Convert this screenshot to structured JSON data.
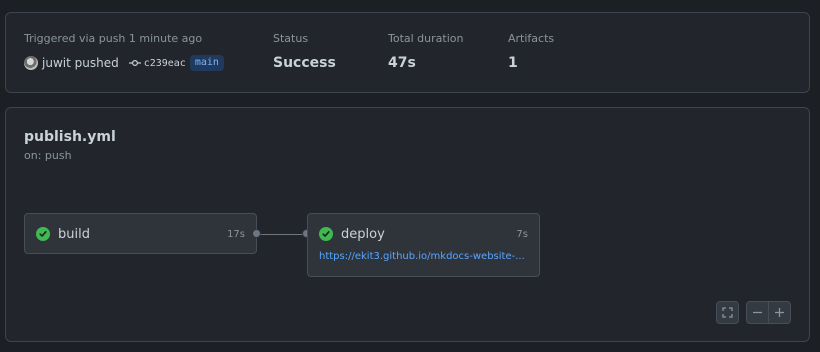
{
  "summary": {
    "trigger_label": "Triggered via push 1 minute ago",
    "pusher": "juwit pushed",
    "commit_sha": "c239eac",
    "branch": "main",
    "status_label": "Status",
    "status_value": "Success",
    "duration_label": "Total duration",
    "duration_value": "47s",
    "artifacts_label": "Artifacts",
    "artifacts_value": "1"
  },
  "workflow": {
    "name": "publish.yml",
    "trigger": "on: push",
    "jobs": [
      {
        "name": "build",
        "duration": "17s",
        "status": "success"
      },
      {
        "name": "deploy",
        "duration": "7s",
        "status": "success",
        "url": "https://ekit3.github.io/mkdocs-website-..."
      }
    ]
  },
  "controls": {
    "fullscreen_icon": "fullscreen-icon",
    "zoom_out_icon": "minus-icon",
    "zoom_in_icon": "plus-icon"
  },
  "colors": {
    "success": "#3fb950",
    "link": "#58a6ff",
    "branch_bg": "#1f3a5e"
  }
}
